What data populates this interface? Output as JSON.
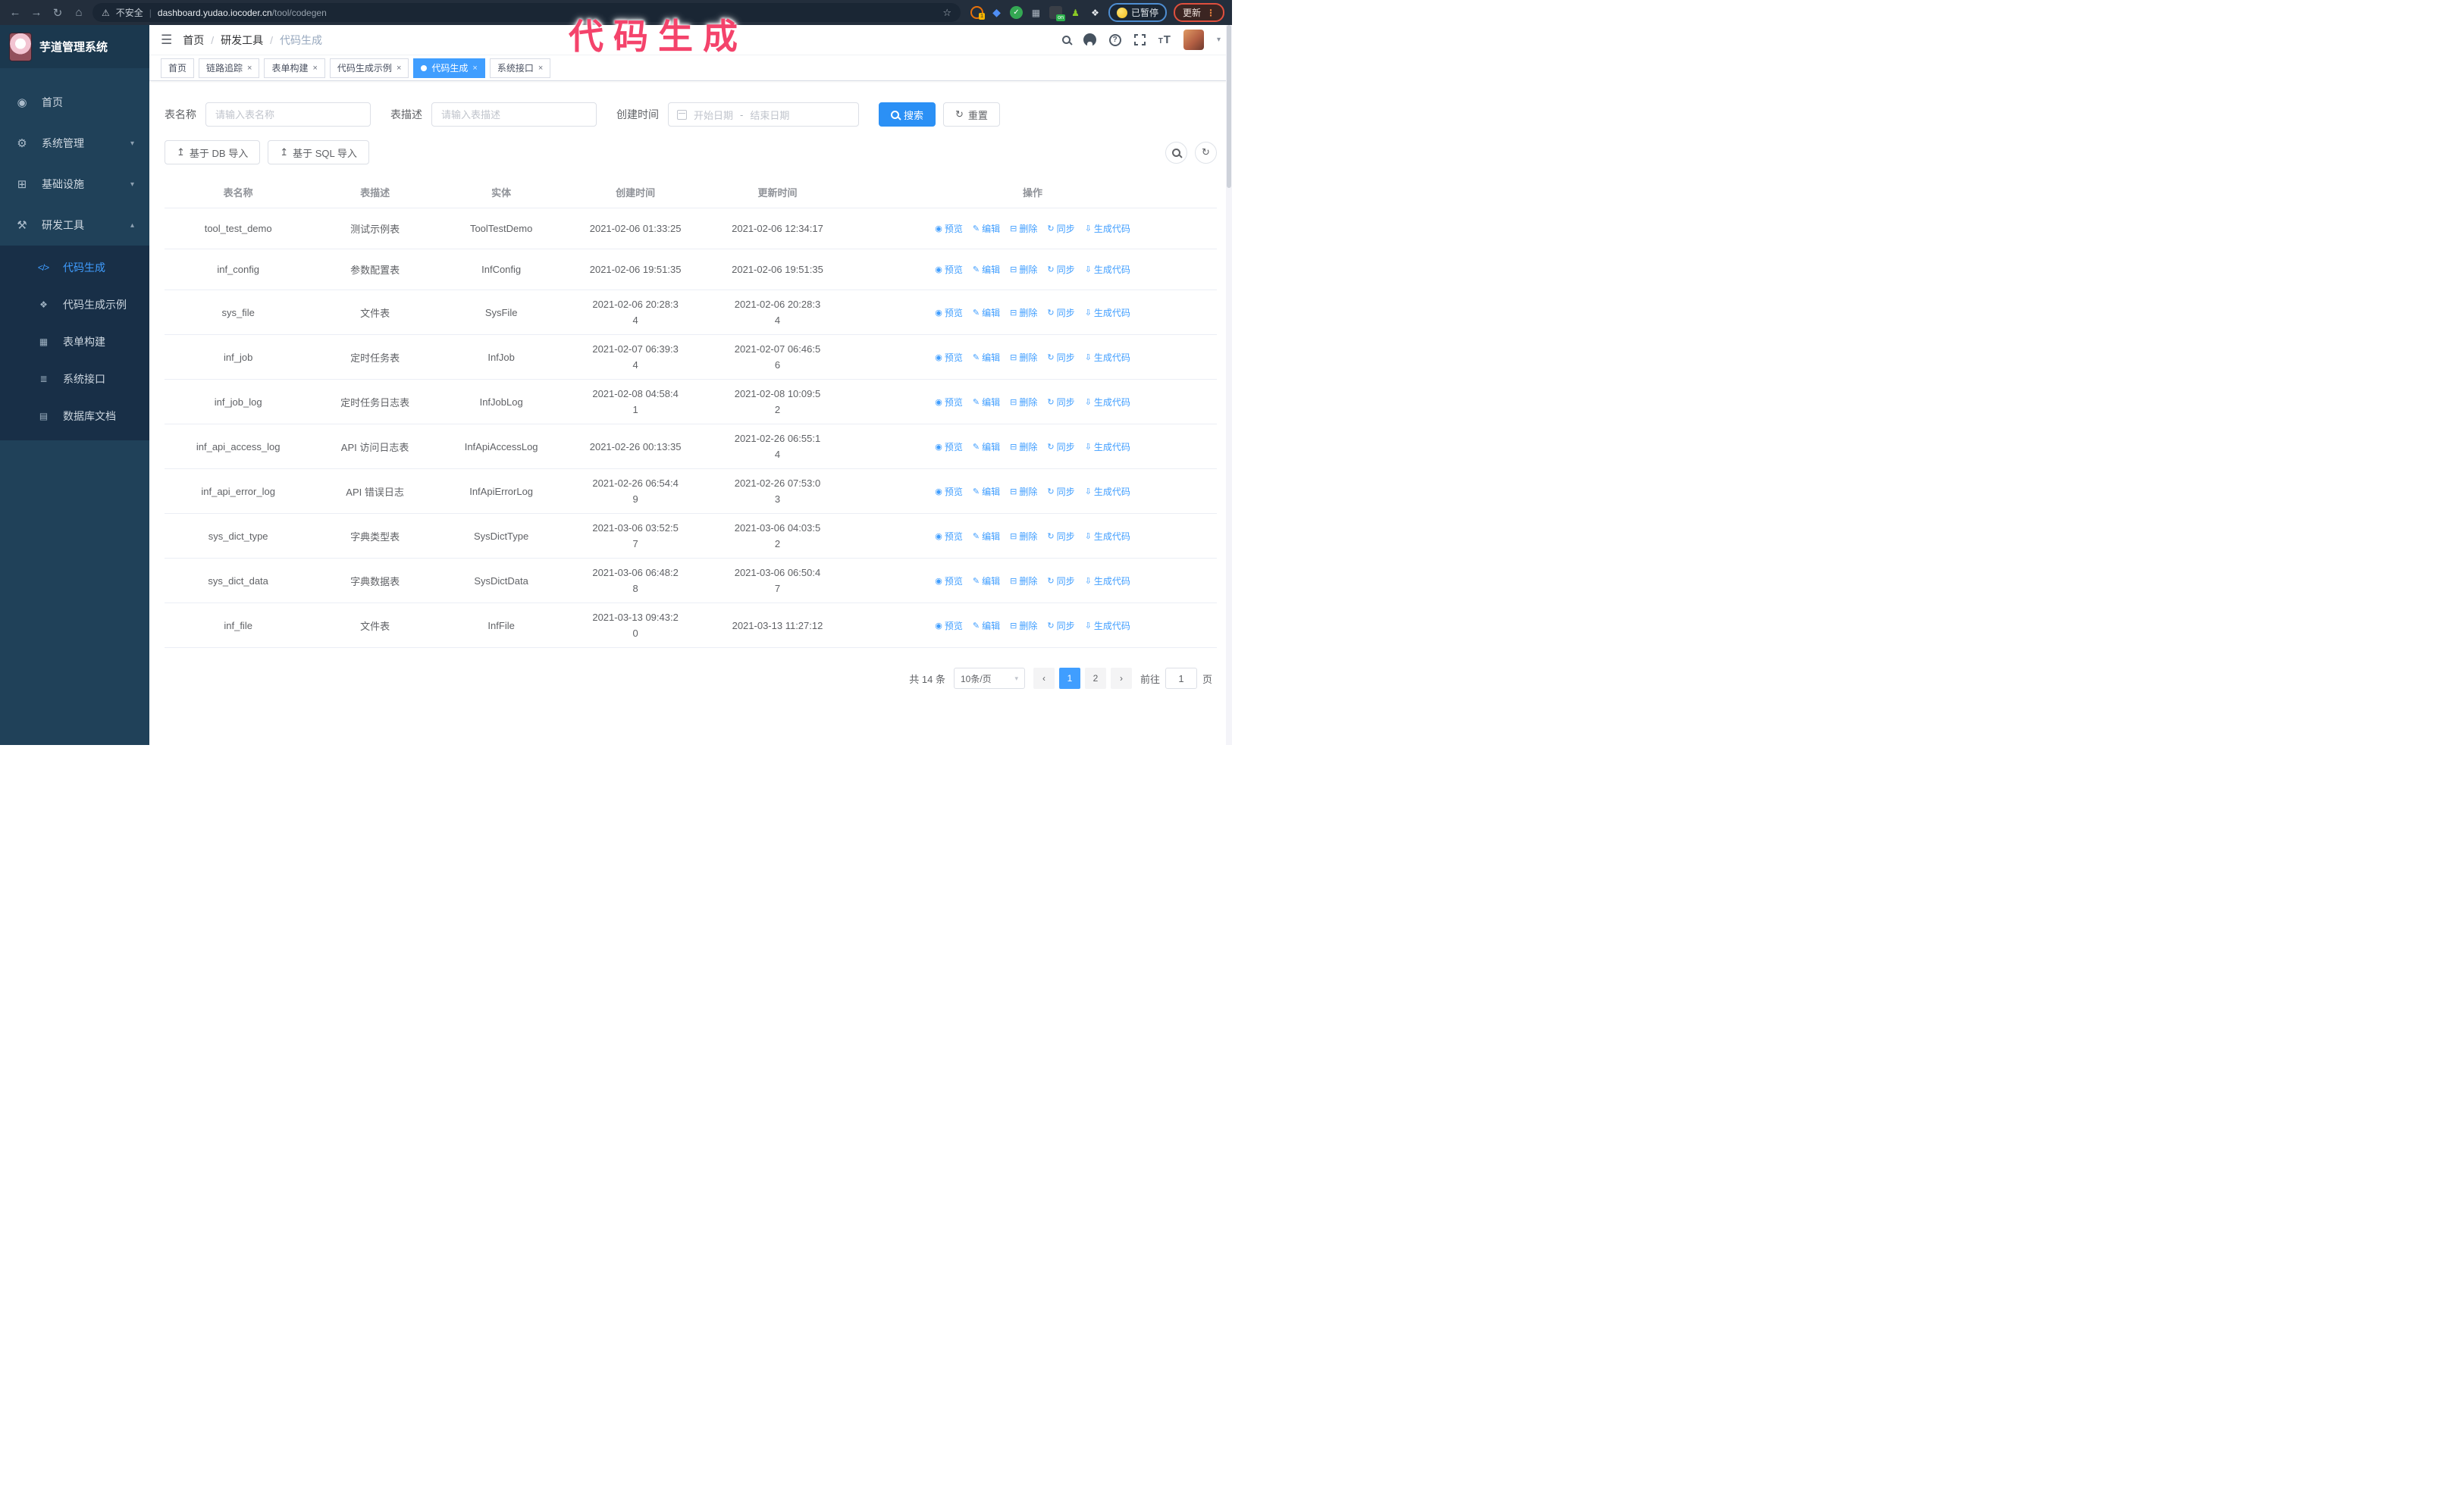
{
  "browser": {
    "security_label": "不安全",
    "url_host": "dashboard.yudao.iocoder.cn",
    "url_path": "/tool/codegen",
    "url_divider": "|",
    "extension_badge_count": "1",
    "extension_badge_on": "on",
    "paused_label": "已暂停",
    "update_label": "更新"
  },
  "annotation": {
    "text": "代码生成",
    "color": "#f4436b"
  },
  "app": {
    "logo_title": "芋道管理系统",
    "breadcrumb": [
      "首页",
      "研发工具",
      "代码生成"
    ],
    "breadcrumb_separator": "/"
  },
  "sidebar": {
    "items": [
      {
        "id": "home",
        "label": "首页",
        "icon": "◉",
        "chevron": ""
      },
      {
        "id": "system",
        "label": "系统管理",
        "icon": "⚙",
        "chevron": "down"
      },
      {
        "id": "infra",
        "label": "基础设施",
        "icon": "⊞",
        "chevron": "down"
      },
      {
        "id": "devtool",
        "label": "研发工具",
        "icon": "⚒",
        "chevron": "up"
      }
    ],
    "submenu": [
      {
        "id": "codegen",
        "label": "代码生成",
        "icon": "</>",
        "active": true
      },
      {
        "id": "codegen-demo",
        "label": "代码生成示例",
        "icon": "❖",
        "active": false
      },
      {
        "id": "form-builder",
        "label": "表单构建",
        "icon": "▦",
        "active": false
      },
      {
        "id": "system-api",
        "label": "系统接口",
        "icon": "≣",
        "active": false
      },
      {
        "id": "db-doc",
        "label": "数据库文档",
        "icon": "▤",
        "active": false
      }
    ]
  },
  "tabs": [
    {
      "id": "home",
      "label": "首页",
      "closable": false,
      "active": false
    },
    {
      "id": "trace",
      "label": "链路追踪",
      "closable": true,
      "active": false
    },
    {
      "id": "form-builder",
      "label": "表单构建",
      "closable": true,
      "active": false
    },
    {
      "id": "codegen-demo",
      "label": "代码生成示例",
      "closable": true,
      "active": false
    },
    {
      "id": "codegen",
      "label": "代码生成",
      "closable": true,
      "active": true
    },
    {
      "id": "system-api",
      "label": "系统接口",
      "closable": true,
      "active": false
    }
  ],
  "filters": {
    "table_name_label": "表名称",
    "table_name_placeholder": "请输入表名称",
    "table_desc_label": "表描述",
    "table_desc_placeholder": "请输入表描述",
    "create_time_label": "创建时间",
    "date_start_placeholder": "开始日期",
    "date_separator": "-",
    "date_end_placeholder": "结束日期",
    "search_label": "搜索",
    "reset_label": "重置"
  },
  "toolbar": {
    "import_db_label": "基于 DB 导入",
    "import_sql_label": "基于 SQL 导入"
  },
  "table": {
    "columns": [
      "表名称",
      "表描述",
      "实体",
      "创建时间",
      "更新时间",
      "操作"
    ],
    "actions": [
      {
        "id": "preview",
        "label": "预览",
        "icon": "◉"
      },
      {
        "id": "edit",
        "label": "编辑",
        "icon": "✎"
      },
      {
        "id": "delete",
        "label": "删除",
        "icon": "⊟"
      },
      {
        "id": "sync",
        "label": "同步",
        "icon": "↻"
      },
      {
        "id": "generate",
        "label": "生成代码",
        "icon": "⇩"
      }
    ],
    "rows": [
      {
        "name": "tool_test_demo",
        "desc": "测试示例表",
        "entity": "ToolTestDemo",
        "created": "2021-02-06 01:33:25",
        "updated": "2021-02-06 12:34:17"
      },
      {
        "name": "inf_config",
        "desc": "参数配置表",
        "entity": "InfConfig",
        "created": "2021-02-06 19:51:35",
        "updated": "2021-02-06 19:51:35"
      },
      {
        "name": "sys_file",
        "desc": "文件表",
        "entity": "SysFile",
        "created": "2021-02-06 20:28:3\n4",
        "updated": "2021-02-06 20:28:3\n4"
      },
      {
        "name": "inf_job",
        "desc": "定时任务表",
        "entity": "InfJob",
        "created": "2021-02-07 06:39:3\n4",
        "updated": "2021-02-07 06:46:5\n6"
      },
      {
        "name": "inf_job_log",
        "desc": "定时任务日志表",
        "entity": "InfJobLog",
        "created": "2021-02-08 04:58:4\n1",
        "updated": "2021-02-08 10:09:5\n2"
      },
      {
        "name": "inf_api_access_log",
        "desc": "API 访问日志表",
        "entity": "InfApiAccessLog",
        "created": "2021-02-26 00:13:35",
        "updated": "2021-02-26 06:55:1\n4"
      },
      {
        "name": "inf_api_error_log",
        "desc": "API 错误日志",
        "entity": "InfApiErrorLog",
        "created": "2021-02-26 06:54:4\n9",
        "updated": "2021-02-26 07:53:0\n3"
      },
      {
        "name": "sys_dict_type",
        "desc": "字典类型表",
        "entity": "SysDictType",
        "created": "2021-03-06 03:52:5\n7",
        "updated": "2021-03-06 04:03:5\n2"
      },
      {
        "name": "sys_dict_data",
        "desc": "字典数据表",
        "entity": "SysDictData",
        "created": "2021-03-06 06:48:2\n8",
        "updated": "2021-03-06 06:50:4\n7"
      },
      {
        "name": "inf_file",
        "desc": "文件表",
        "entity": "InfFile",
        "created": "2021-03-13 09:43:2\n0",
        "updated": "2021-03-13 11:27:12"
      }
    ]
  },
  "pagination": {
    "total_label": "共 14 条",
    "page_size_label": "10条/页",
    "prev_icon": "‹",
    "next_icon": "›",
    "pages": [
      "1",
      "2"
    ],
    "active_page": "1",
    "goto_label": "前往",
    "goto_value": "1",
    "page_suffix_label": "页"
  },
  "colors": {
    "primary": "#409EFF",
    "sidebar_bg": "#204159",
    "submenu_bg": "#182f47",
    "browser_bar_bg": "#232e3c",
    "annotation_pink": "#f4436b",
    "paused_border_blue": "#4e8ed2",
    "update_border_red": "#df4f3e"
  }
}
